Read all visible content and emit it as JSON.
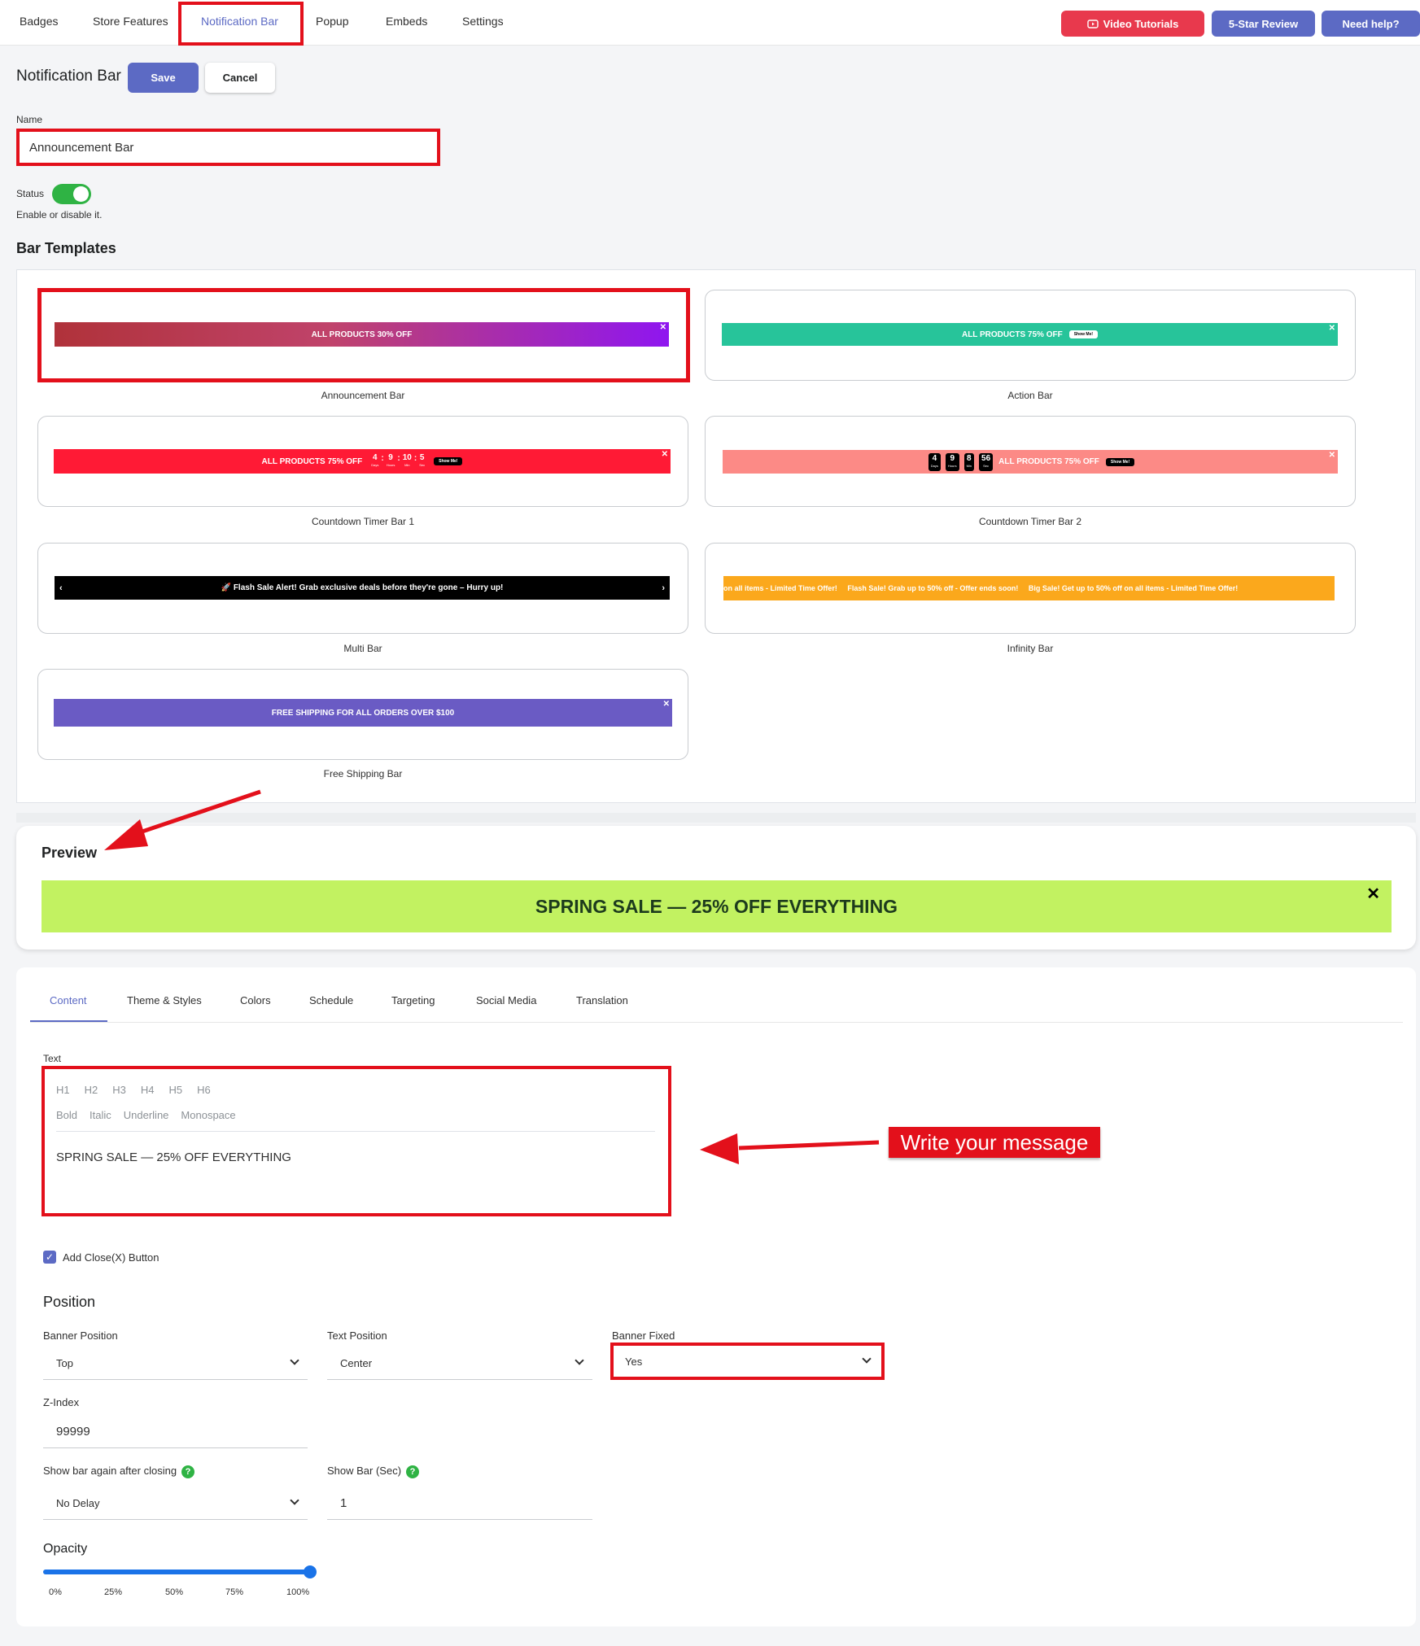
{
  "nav": {
    "tabs": [
      "Badges",
      "Store Features",
      "Notification Bar",
      "Popup",
      "Embeds",
      "Settings"
    ],
    "active_tab": "Notification Bar",
    "video_tutorials": "Video Tutorials",
    "five_star": "5-Star Review",
    "need_help": "Need help?"
  },
  "page": {
    "title": "Notification Bar",
    "save": "Save",
    "cancel": "Cancel"
  },
  "form": {
    "name_label": "Name",
    "name_value": "Announcement Bar",
    "status_label": "Status",
    "status_on": true,
    "status_help": "Enable or disable it."
  },
  "templates": {
    "heading": "Bar Templates",
    "items": [
      {
        "label": "Announcement Bar",
        "bar_text": "ALL PRODUCTS 30% OFF"
      },
      {
        "label": "Action Bar",
        "bar_text": "ALL PRODUCTS 75% OFF",
        "button": "Show Me!"
      },
      {
        "label": "Countdown Timer Bar 1",
        "bar_text": "ALL PRODUCTS 75% OFF",
        "button": "Show Me!",
        "timer": [
          {
            "v": "4",
            "u": "Days"
          },
          {
            "v": "9",
            "u": "Hours"
          },
          {
            "v": "10",
            "u": "Min"
          },
          {
            "v": "5",
            "u": "Sec"
          }
        ]
      },
      {
        "label": "Countdown Timer Bar 2",
        "bar_text": "ALL PRODUCTS 75% OFF",
        "button": "Show Me!",
        "timer": [
          {
            "v": "4",
            "u": "Days"
          },
          {
            "v": "9",
            "u": "Hours"
          },
          {
            "v": "8",
            "u": "Min"
          },
          {
            "v": "56",
            "u": "Sec"
          }
        ]
      },
      {
        "label": "Multi Bar",
        "bar_text": "🚀 Flash Sale Alert! Grab exclusive deals before they're gone – Hurry up!"
      },
      {
        "label": "Infinity Bar",
        "bar_text": "on all items - Limited Time Offer!     Flash Sale! Grab up to 50% off - Offer ends soon!     Big Sale! Get up to 50% off on all items - Limited Time Offer!"
      },
      {
        "label": "Free Shipping Bar",
        "bar_text": "FREE SHIPPING FOR ALL ORDERS OVER $100"
      }
    ]
  },
  "preview": {
    "heading": "Preview",
    "text": "SPRING SALE — 25% OFF EVERYTHING",
    "bg_color": "#c2f261"
  },
  "settings_tabs": [
    "Content",
    "Theme & Styles",
    "Colors",
    "Schedule",
    "Targeting",
    "Social Media",
    "Translation"
  ],
  "editor": {
    "label": "Text",
    "headings": [
      "H1",
      "H2",
      "H3",
      "H4",
      "H5",
      "H6"
    ],
    "formats": [
      "Bold",
      "Italic",
      "Underline",
      "Monospace"
    ],
    "content": "SPRING SALE — 25% OFF EVERYTHING"
  },
  "annotation": {
    "callout": "Write your message"
  },
  "close_button": {
    "label": "Add Close(X) Button",
    "checked": true
  },
  "position": {
    "heading": "Position",
    "banner_position_label": "Banner Position",
    "banner_position_value": "Top",
    "text_position_label": "Text Position",
    "text_position_value": "Center",
    "banner_fixed_label": "Banner Fixed",
    "banner_fixed_value": "Yes",
    "zindex_label": "Z-Index",
    "zindex_value": "99999",
    "show_again_label": "Show bar again after closing",
    "show_again_value": "No Delay",
    "show_bar_label": "Show Bar (Sec)",
    "show_bar_value": "1"
  },
  "opacity": {
    "heading": "Opacity",
    "ticks": [
      "0%",
      "25%",
      "50%",
      "75%",
      "100%"
    ],
    "value_percent": 100
  },
  "colors": {
    "accent": "#5c6ac4",
    "red_btn": "#e8394d",
    "toggle_green": "#2fb344",
    "annotation_red": "#e3101b"
  }
}
